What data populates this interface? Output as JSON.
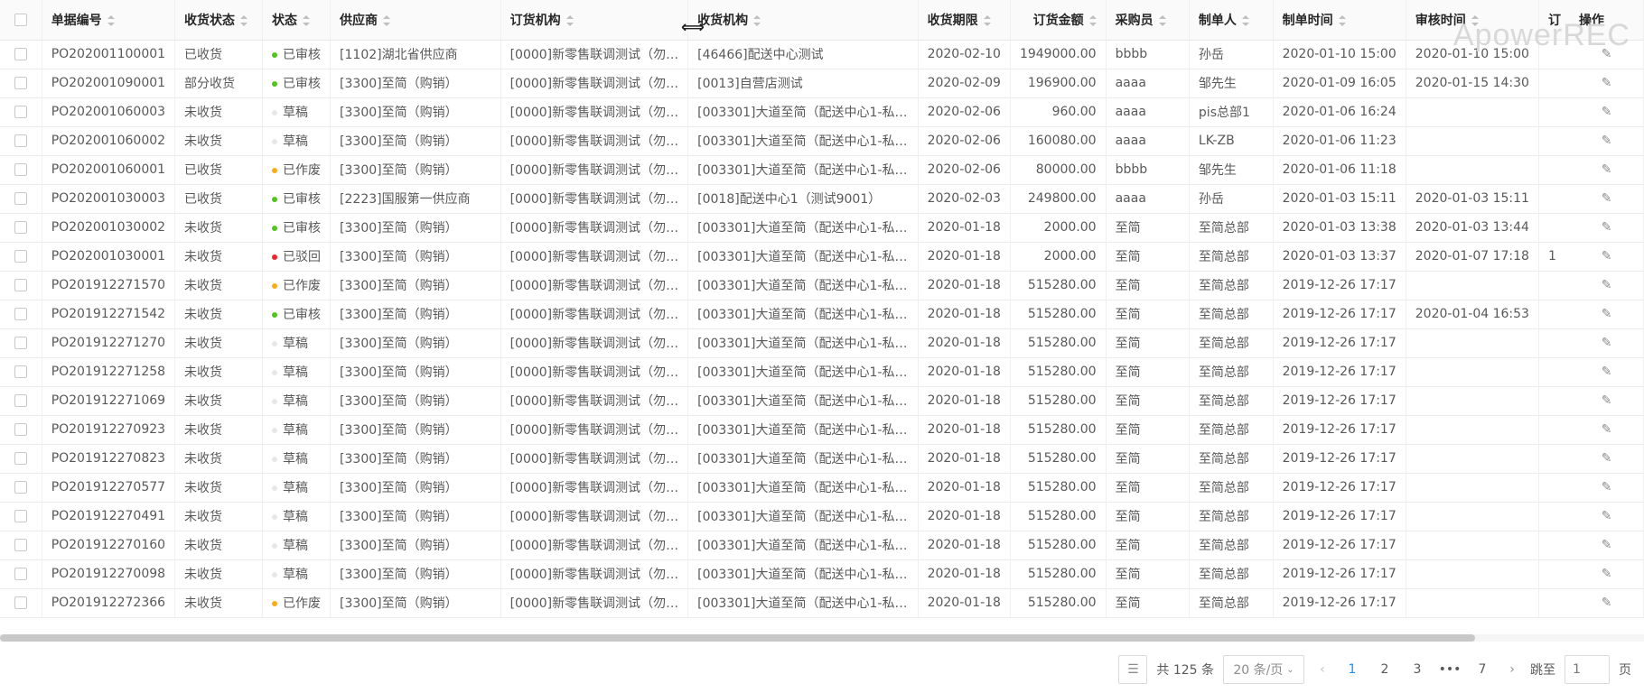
{
  "table": {
    "columns": [
      {
        "key": "id",
        "label": "单据编号"
      },
      {
        "key": "receipt",
        "label": "收货状态"
      },
      {
        "key": "status",
        "label": "状态"
      },
      {
        "key": "supplier",
        "label": "供应商"
      },
      {
        "key": "order_org",
        "label": "订货机构"
      },
      {
        "key": "recv_org",
        "label": "收货机构"
      },
      {
        "key": "deadline",
        "label": "收货期限"
      },
      {
        "key": "amount",
        "label": "订货金额"
      },
      {
        "key": "buyer",
        "label": "采购员"
      },
      {
        "key": "creator",
        "label": "制单人"
      },
      {
        "key": "created",
        "label": "制单时间"
      },
      {
        "key": "audited",
        "label": "审核时间"
      },
      {
        "key": "partial",
        "label": "订"
      },
      {
        "key": "action",
        "label": "操作"
      }
    ],
    "status_colors": {
      "已审核": "#52c41a",
      "草稿": "#e8e8e8",
      "已作废": "#faad14",
      "已驳回": "#f5222d"
    },
    "rows": [
      {
        "id": "PO202001100001",
        "receipt": "已收货",
        "status": "已审核",
        "supplier": "[1102]湖北省供应商",
        "order_org": "[0000]新零售联调测试（勿…",
        "recv_org": "[46466]配送中心测试",
        "deadline": "2020-02-10",
        "amount": "1949000.00",
        "buyer": "bbbb",
        "creator": "孙岳",
        "created": "2020-01-10 15:00",
        "audited": "2020-01-10 15:00",
        "partial": ""
      },
      {
        "id": "PO202001090001",
        "receipt": "部分收货",
        "status": "已审核",
        "supplier": "[3300]至简（购销）",
        "order_org": "[0000]新零售联调测试（勿…",
        "recv_org": "[0013]自营店测试",
        "deadline": "2020-02-09",
        "amount": "196900.00",
        "buyer": "aaaa",
        "creator": "邹先生",
        "created": "2020-01-09 16:05",
        "audited": "2020-01-15 14:30",
        "partial": ""
      },
      {
        "id": "PO202001060003",
        "receipt": "未收货",
        "status": "草稿",
        "supplier": "[3300]至简（购销）",
        "order_org": "[0000]新零售联调测试（勿…",
        "recv_org": "[003301]大道至简（配送中心1-私…",
        "deadline": "2020-02-06",
        "amount": "960.00",
        "buyer": "aaaa",
        "creator": "pis总部1",
        "created": "2020-01-06 16:24",
        "audited": "",
        "partial": ""
      },
      {
        "id": "PO202001060002",
        "receipt": "未收货",
        "status": "草稿",
        "supplier": "[3300]至简（购销）",
        "order_org": "[0000]新零售联调测试（勿…",
        "recv_org": "[003301]大道至简（配送中心1-私…",
        "deadline": "2020-02-06",
        "amount": "160080.00",
        "buyer": "aaaa",
        "creator": "LK-ZB",
        "created": "2020-01-06 11:23",
        "audited": "",
        "partial": ""
      },
      {
        "id": "PO202001060001",
        "receipt": "已收货",
        "status": "已作废",
        "supplier": "[3300]至简（购销）",
        "order_org": "[0000]新零售联调测试（勿…",
        "recv_org": "[003301]大道至简（配送中心1-私…",
        "deadline": "2020-02-06",
        "amount": "80000.00",
        "buyer": "bbbb",
        "creator": "邹先生",
        "created": "2020-01-06 11:18",
        "audited": "",
        "partial": ""
      },
      {
        "id": "PO202001030003",
        "receipt": "已收货",
        "status": "已审核",
        "supplier": "[2223]国服第一供应商",
        "order_org": "[0000]新零售联调测试（勿…",
        "recv_org": "[0018]配送中心1（测试9001）",
        "deadline": "2020-02-03",
        "amount": "249800.00",
        "buyer": "aaaa",
        "creator": "孙岳",
        "created": "2020-01-03 15:11",
        "audited": "2020-01-03 15:11",
        "partial": ""
      },
      {
        "id": "PO202001030002",
        "receipt": "未收货",
        "status": "已审核",
        "supplier": "[3300]至简（购销）",
        "order_org": "[0000]新零售联调测试（勿…",
        "recv_org": "[003301]大道至简（配送中心1-私…",
        "deadline": "2020-01-18",
        "amount": "2000.00",
        "buyer": "至简",
        "creator": "至简总部",
        "created": "2020-01-03 13:38",
        "audited": "2020-01-03 13:44",
        "partial": ""
      },
      {
        "id": "PO202001030001",
        "receipt": "未收货",
        "status": "已驳回",
        "supplier": "[3300]至简（购销）",
        "order_org": "[0000]新零售联调测试（勿…",
        "recv_org": "[003301]大道至简（配送中心1-私…",
        "deadline": "2020-01-18",
        "amount": "2000.00",
        "buyer": "至简",
        "creator": "至简总部",
        "created": "2020-01-03 13:37",
        "audited": "2020-01-07 17:18",
        "partial": "1"
      },
      {
        "id": "PO201912271570",
        "receipt": "未收货",
        "status": "已作废",
        "supplier": "[3300]至简（购销）",
        "order_org": "[0000]新零售联调测试（勿…",
        "recv_org": "[003301]大道至简（配送中心1-私…",
        "deadline": "2020-01-18",
        "amount": "515280.00",
        "buyer": "至简",
        "creator": "至简总部",
        "created": "2019-12-26 17:17",
        "audited": "",
        "partial": ""
      },
      {
        "id": "PO201912271542",
        "receipt": "未收货",
        "status": "已审核",
        "supplier": "[3300]至简（购销）",
        "order_org": "[0000]新零售联调测试（勿…",
        "recv_org": "[003301]大道至简（配送中心1-私…",
        "deadline": "2020-01-18",
        "amount": "515280.00",
        "buyer": "至简",
        "creator": "至简总部",
        "created": "2019-12-26 17:17",
        "audited": "2020-01-04 16:53",
        "partial": ""
      },
      {
        "id": "PO201912271270",
        "receipt": "未收货",
        "status": "草稿",
        "supplier": "[3300]至简（购销）",
        "order_org": "[0000]新零售联调测试（勿…",
        "recv_org": "[003301]大道至简（配送中心1-私…",
        "deadline": "2020-01-18",
        "amount": "515280.00",
        "buyer": "至简",
        "creator": "至简总部",
        "created": "2019-12-26 17:17",
        "audited": "",
        "partial": ""
      },
      {
        "id": "PO201912271258",
        "receipt": "未收货",
        "status": "草稿",
        "supplier": "[3300]至简（购销）",
        "order_org": "[0000]新零售联调测试（勿…",
        "recv_org": "[003301]大道至简（配送中心1-私…",
        "deadline": "2020-01-18",
        "amount": "515280.00",
        "buyer": "至简",
        "creator": "至简总部",
        "created": "2019-12-26 17:17",
        "audited": "",
        "partial": ""
      },
      {
        "id": "PO201912271069",
        "receipt": "未收货",
        "status": "草稿",
        "supplier": "[3300]至简（购销）",
        "order_org": "[0000]新零售联调测试（勿…",
        "recv_org": "[003301]大道至简（配送中心1-私…",
        "deadline": "2020-01-18",
        "amount": "515280.00",
        "buyer": "至简",
        "creator": "至简总部",
        "created": "2019-12-26 17:17",
        "audited": "",
        "partial": ""
      },
      {
        "id": "PO201912270923",
        "receipt": "未收货",
        "status": "草稿",
        "supplier": "[3300]至简（购销）",
        "order_org": "[0000]新零售联调测试（勿…",
        "recv_org": "[003301]大道至简（配送中心1-私…",
        "deadline": "2020-01-18",
        "amount": "515280.00",
        "buyer": "至简",
        "creator": "至简总部",
        "created": "2019-12-26 17:17",
        "audited": "",
        "partial": ""
      },
      {
        "id": "PO201912270823",
        "receipt": "未收货",
        "status": "草稿",
        "supplier": "[3300]至简（购销）",
        "order_org": "[0000]新零售联调测试（勿…",
        "recv_org": "[003301]大道至简（配送中心1-私…",
        "deadline": "2020-01-18",
        "amount": "515280.00",
        "buyer": "至简",
        "creator": "至简总部",
        "created": "2019-12-26 17:17",
        "audited": "",
        "partial": ""
      },
      {
        "id": "PO201912270577",
        "receipt": "未收货",
        "status": "草稿",
        "supplier": "[3300]至简（购销）",
        "order_org": "[0000]新零售联调测试（勿…",
        "recv_org": "[003301]大道至简（配送中心1-私…",
        "deadline": "2020-01-18",
        "amount": "515280.00",
        "buyer": "至简",
        "creator": "至简总部",
        "created": "2019-12-26 17:17",
        "audited": "",
        "partial": ""
      },
      {
        "id": "PO201912270491",
        "receipt": "未收货",
        "status": "草稿",
        "supplier": "[3300]至简（购销）",
        "order_org": "[0000]新零售联调测试（勿…",
        "recv_org": "[003301]大道至简（配送中心1-私…",
        "deadline": "2020-01-18",
        "amount": "515280.00",
        "buyer": "至简",
        "creator": "至简总部",
        "created": "2019-12-26 17:17",
        "audited": "",
        "partial": ""
      },
      {
        "id": "PO201912270160",
        "receipt": "未收货",
        "status": "草稿",
        "supplier": "[3300]至简（购销）",
        "order_org": "[0000]新零售联调测试（勿…",
        "recv_org": "[003301]大道至简（配送中心1-私…",
        "deadline": "2020-01-18",
        "amount": "515280.00",
        "buyer": "至简",
        "creator": "至简总部",
        "created": "2019-12-26 17:17",
        "audited": "",
        "partial": ""
      },
      {
        "id": "PO201912270098",
        "receipt": "未收货",
        "status": "草稿",
        "supplier": "[3300]至简（购销）",
        "order_org": "[0000]新零售联调测试（勿…",
        "recv_org": "[003301]大道至简（配送中心1-私…",
        "deadline": "2020-01-18",
        "amount": "515280.00",
        "buyer": "至简",
        "creator": "至简总部",
        "created": "2019-12-26 17:17",
        "audited": "",
        "partial": ""
      },
      {
        "id": "PO201912272366",
        "receipt": "未收货",
        "status": "已作废",
        "supplier": "[3300]至简（购销）",
        "order_org": "[0000]新零售联调测试（勿…",
        "recv_org": "[003301]大道至简（配送中心1-私…",
        "deadline": "2020-01-18",
        "amount": "515280.00",
        "buyer": "至简",
        "creator": "至简总部",
        "created": "2019-12-26 17:17",
        "audited": "",
        "partial": ""
      }
    ]
  },
  "watermark": "ApowerREC",
  "icons": {
    "edit": "edit-icon",
    "settings": "column-settings-icon",
    "resize": "col-resize-cursor-icon"
  },
  "pagination": {
    "total_text": "共 125 条",
    "page_size": "20 条/页",
    "pages": [
      "1",
      "2",
      "3",
      "•••",
      "7"
    ],
    "current_page": "1",
    "jump_label": "跳至",
    "jump_placeholder": "1",
    "page_suffix": "页"
  }
}
